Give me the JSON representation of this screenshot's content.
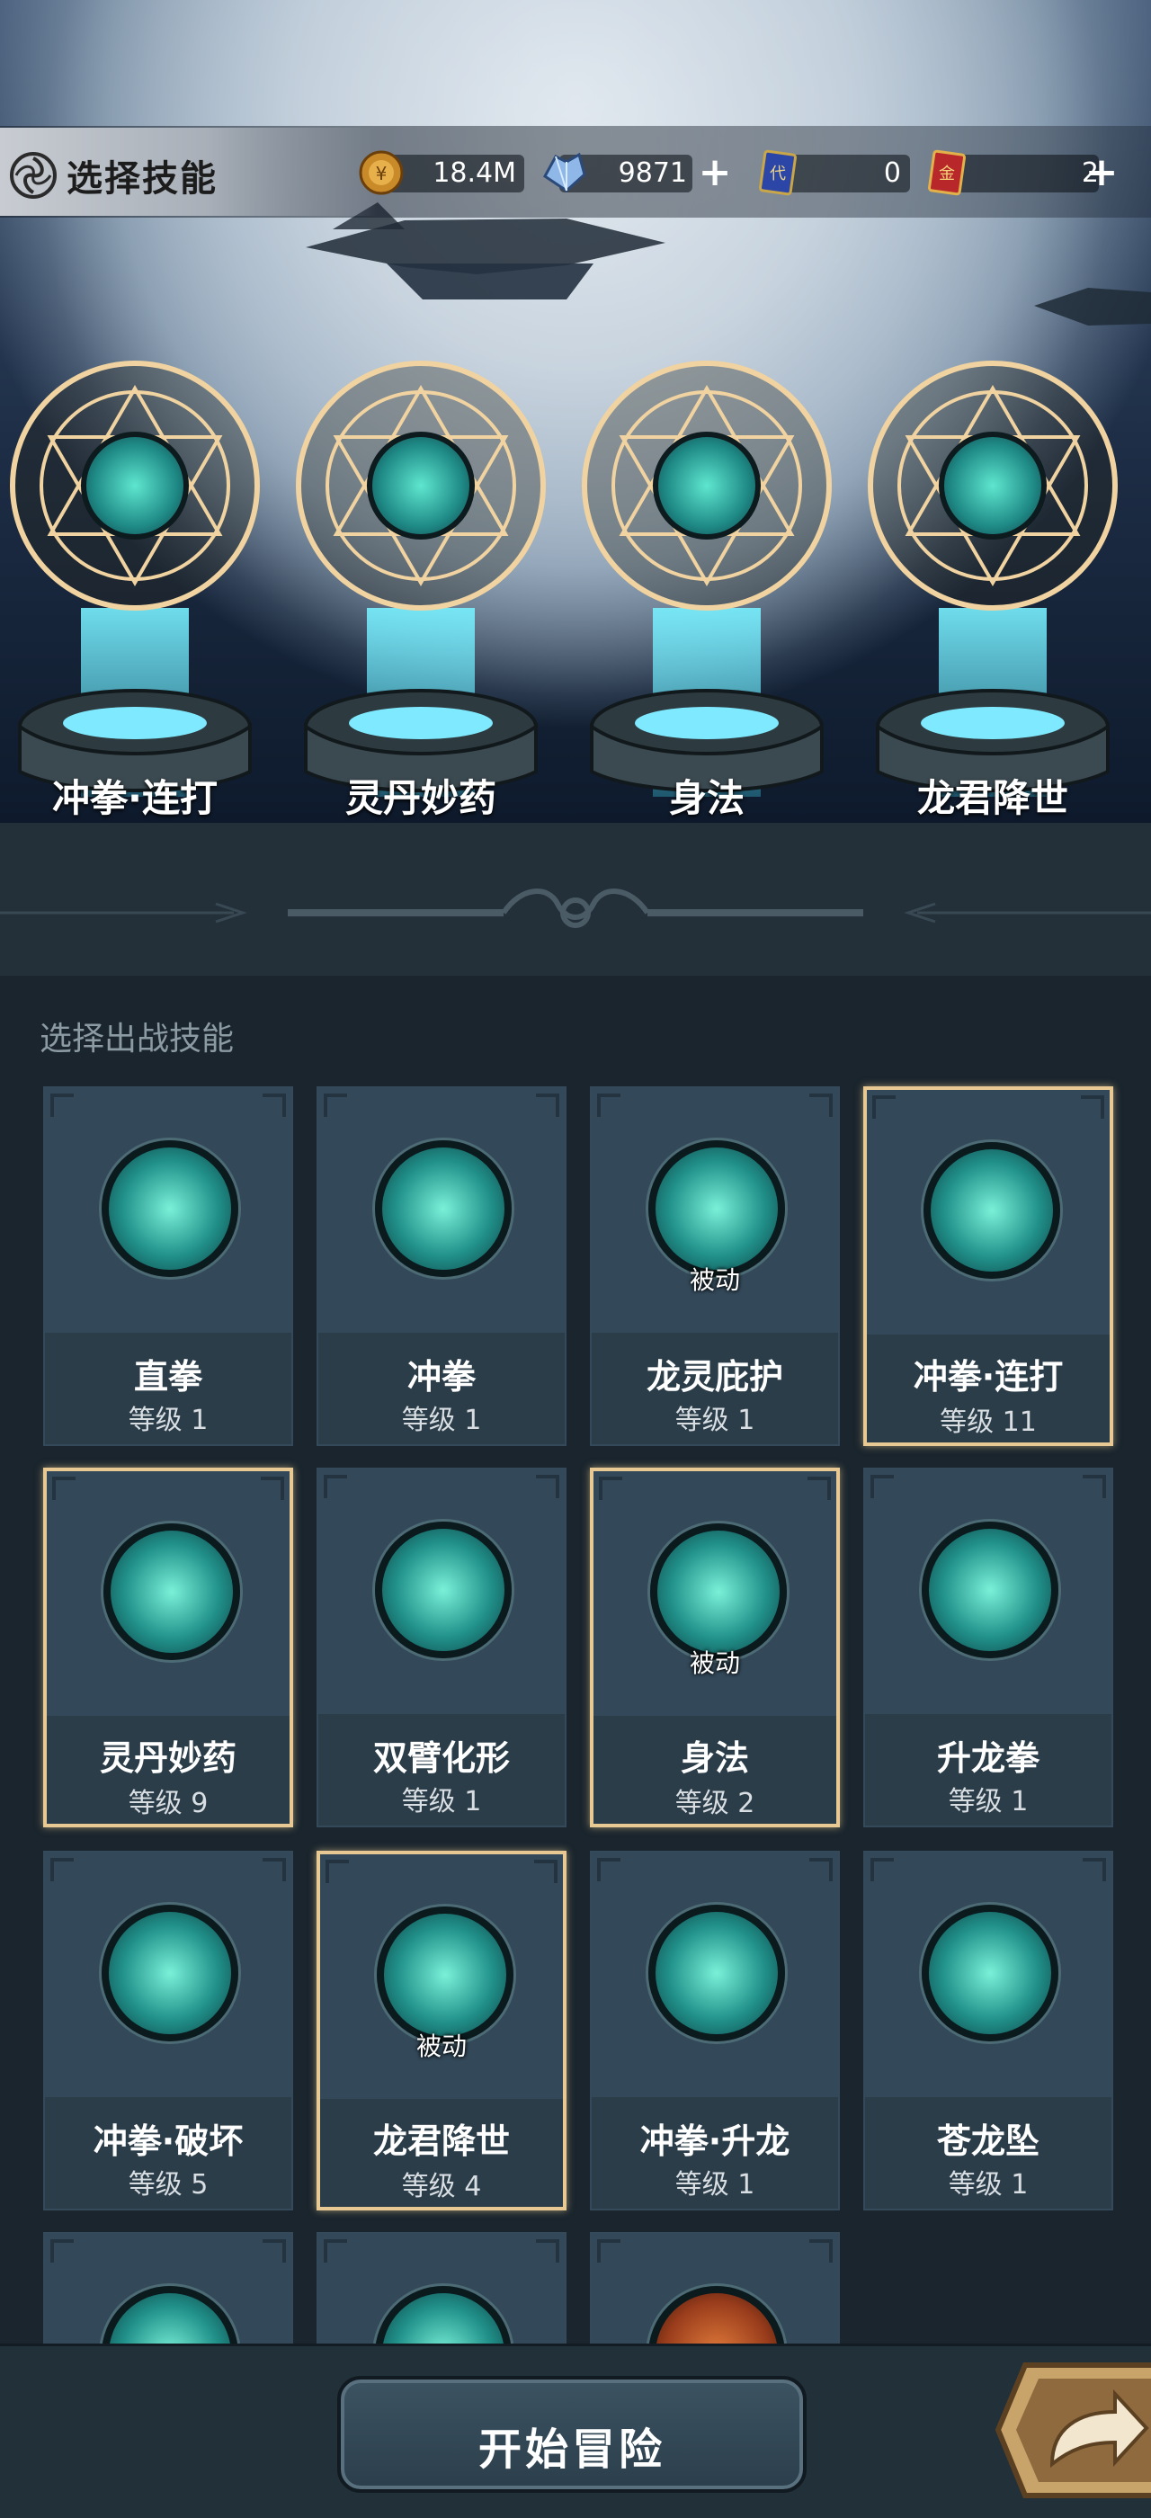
{
  "header": {
    "title": "选择技能",
    "currencies": [
      {
        "icon": "gold-coin-icon",
        "value": "18.4M",
        "has_plus": false
      },
      {
        "icon": "crystal-gem-icon",
        "value": "9871",
        "has_plus": true
      },
      {
        "icon": "blue-card-icon",
        "value": "0",
        "has_plus": false
      },
      {
        "icon": "red-card-icon",
        "value": "2",
        "has_plus": true
      }
    ]
  },
  "equipped": [
    {
      "name": "冲拳·连打",
      "icon": "fist-combo-icon"
    },
    {
      "name": "灵丹妙药",
      "icon": "gourd-potion-icon"
    },
    {
      "name": "身法",
      "icon": "shadow-crossed-blades-icon"
    },
    {
      "name": "龙君降世",
      "icon": "dragon-icon"
    }
  ],
  "section_label": "选择出战技能",
  "skills": [
    {
      "name": "直拳",
      "level": "等级 1",
      "passive": "",
      "selected": false,
      "icon": "straight-punch-icon"
    },
    {
      "name": "冲拳",
      "level": "等级 1",
      "passive": "",
      "selected": false,
      "icon": "dragon-fist-icon"
    },
    {
      "name": "龙灵庇护",
      "level": "等级 1",
      "passive": "被动",
      "selected": false,
      "icon": "dragon-spirit-shield-icon"
    },
    {
      "name": "冲拳·连打",
      "level": "等级 11",
      "passive": "",
      "selected": true,
      "icon": "fist-combo-icon"
    },
    {
      "name": "灵丹妙药",
      "level": "等级 9",
      "passive": "",
      "selected": true,
      "icon": "gourd-potion-icon"
    },
    {
      "name": "双臂化形",
      "level": "等级 1",
      "passive": "",
      "selected": false,
      "icon": "twin-arms-icon"
    },
    {
      "name": "身法",
      "level": "等级 2",
      "passive": "被动",
      "selected": true,
      "icon": "shadow-crossed-blades-icon"
    },
    {
      "name": "升龙拳",
      "level": "等级 1",
      "passive": "",
      "selected": false,
      "icon": "rising-dragon-fist-icon"
    },
    {
      "name": "冲拳·破坏",
      "level": "等级 5",
      "passive": "",
      "selected": false,
      "icon": "piercing-fist-icon"
    },
    {
      "name": "龙君降世",
      "level": "等级 4",
      "passive": "被动",
      "selected": true,
      "icon": "dragon-icon"
    },
    {
      "name": "冲拳·升龙",
      "level": "等级 1",
      "passive": "",
      "selected": false,
      "icon": "rising-strike-icon"
    },
    {
      "name": "苍龙坠",
      "level": "等级 1",
      "passive": "",
      "selected": false,
      "icon": "azure-dragon-fall-icon"
    },
    {
      "name": "",
      "level": "",
      "passive": "",
      "selected": false,
      "icon": "wind-slash-icon"
    },
    {
      "name": "",
      "level": "",
      "passive": "",
      "selected": false,
      "icon": "cyan-burst-icon"
    },
    {
      "name": "",
      "level": "",
      "passive": "",
      "selected": false,
      "icon": "fire-relic-icon"
    }
  ],
  "buttons": {
    "start": "开始冒险",
    "next_icon": "share-arrow-icon"
  },
  "colors": {
    "selected_border": "#e8c993",
    "card_bg": "#2b3d49",
    "panel_bg": "#1a252d",
    "skill_glow": "#5ee6cf"
  }
}
